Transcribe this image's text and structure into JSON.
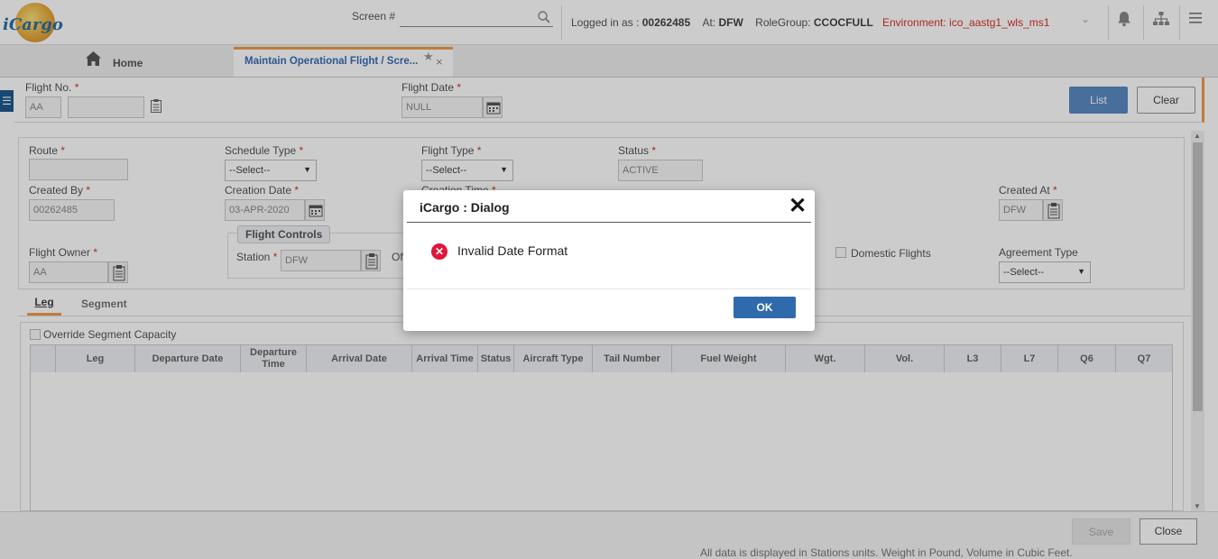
{
  "app": {
    "logo_text": "iCargo"
  },
  "topbar": {
    "screen_label": "Screen #",
    "screen_value": "",
    "logged_in_label": "Logged in as : ",
    "user_id": "00262485",
    "at_label": "At: ",
    "station": "DFW",
    "rolegroup_label": "RoleGroup: ",
    "rolegroup": "CCOCFULL",
    "environment": "Environment: ico_aastg1_wls_ms1"
  },
  "tabs": {
    "home": "Home",
    "active": "Maintain Operational Flight / Scre..."
  },
  "header": {
    "flight_no_label": "Flight No.",
    "carrier": "AA",
    "flight_number": "",
    "flight_date_label": "Flight Date",
    "flight_date": "NULL",
    "list_button": "List",
    "clear_button": "Clear"
  },
  "form": {
    "route_label": "Route",
    "route": "",
    "schedule_type_label": "Schedule Type",
    "schedule_type": "--Select--",
    "flight_type_label": "Flight Type",
    "flight_type": "--Select--",
    "status_label": "Status",
    "status": "ACTIVE",
    "created_by_label": "Created By",
    "created_by": "00262485",
    "creation_date_label": "Creation Date",
    "creation_date": "03-APR-2020",
    "creation_time_label": "Creation Time",
    "created_at_label": "Created At",
    "created_at": "DFW",
    "flight_owner_label": "Flight Owner",
    "flight_owner": "AA",
    "flight_controls_legend": "Flight Controls",
    "station_label": "Station",
    "station": "DFW",
    "of_label": "Of",
    "domestic_flights_label": "Domestic Flights",
    "agreement_type_label": "Agreement Type",
    "agreement_type": "--Select--"
  },
  "subtabs": {
    "leg": "Leg",
    "segment": "Segment"
  },
  "grid": {
    "override_label": "Override Segment Capacity",
    "columns": [
      "Leg",
      "Departure Date",
      "Departure Time",
      "Arrival Date",
      "Arrival Time",
      "Status",
      "Aircraft Type",
      "Tail Number",
      "Fuel Weight",
      "Wgt.",
      "Vol.",
      "L3",
      "L7",
      "Q6",
      "Q7"
    ]
  },
  "footer": {
    "save_button": "Save",
    "close_button": "Close",
    "note": "All data is displayed in Stations units. Weight in Pound, Volume in Cubic Feet."
  },
  "dialog": {
    "title": "iCargo : Dialog",
    "message": "Invalid Date Format",
    "ok_button": "OK"
  },
  "colors": {
    "accent": "#f29b4a",
    "primary": "#2f6aad",
    "error": "#e0163a",
    "env": "#d9342b"
  }
}
